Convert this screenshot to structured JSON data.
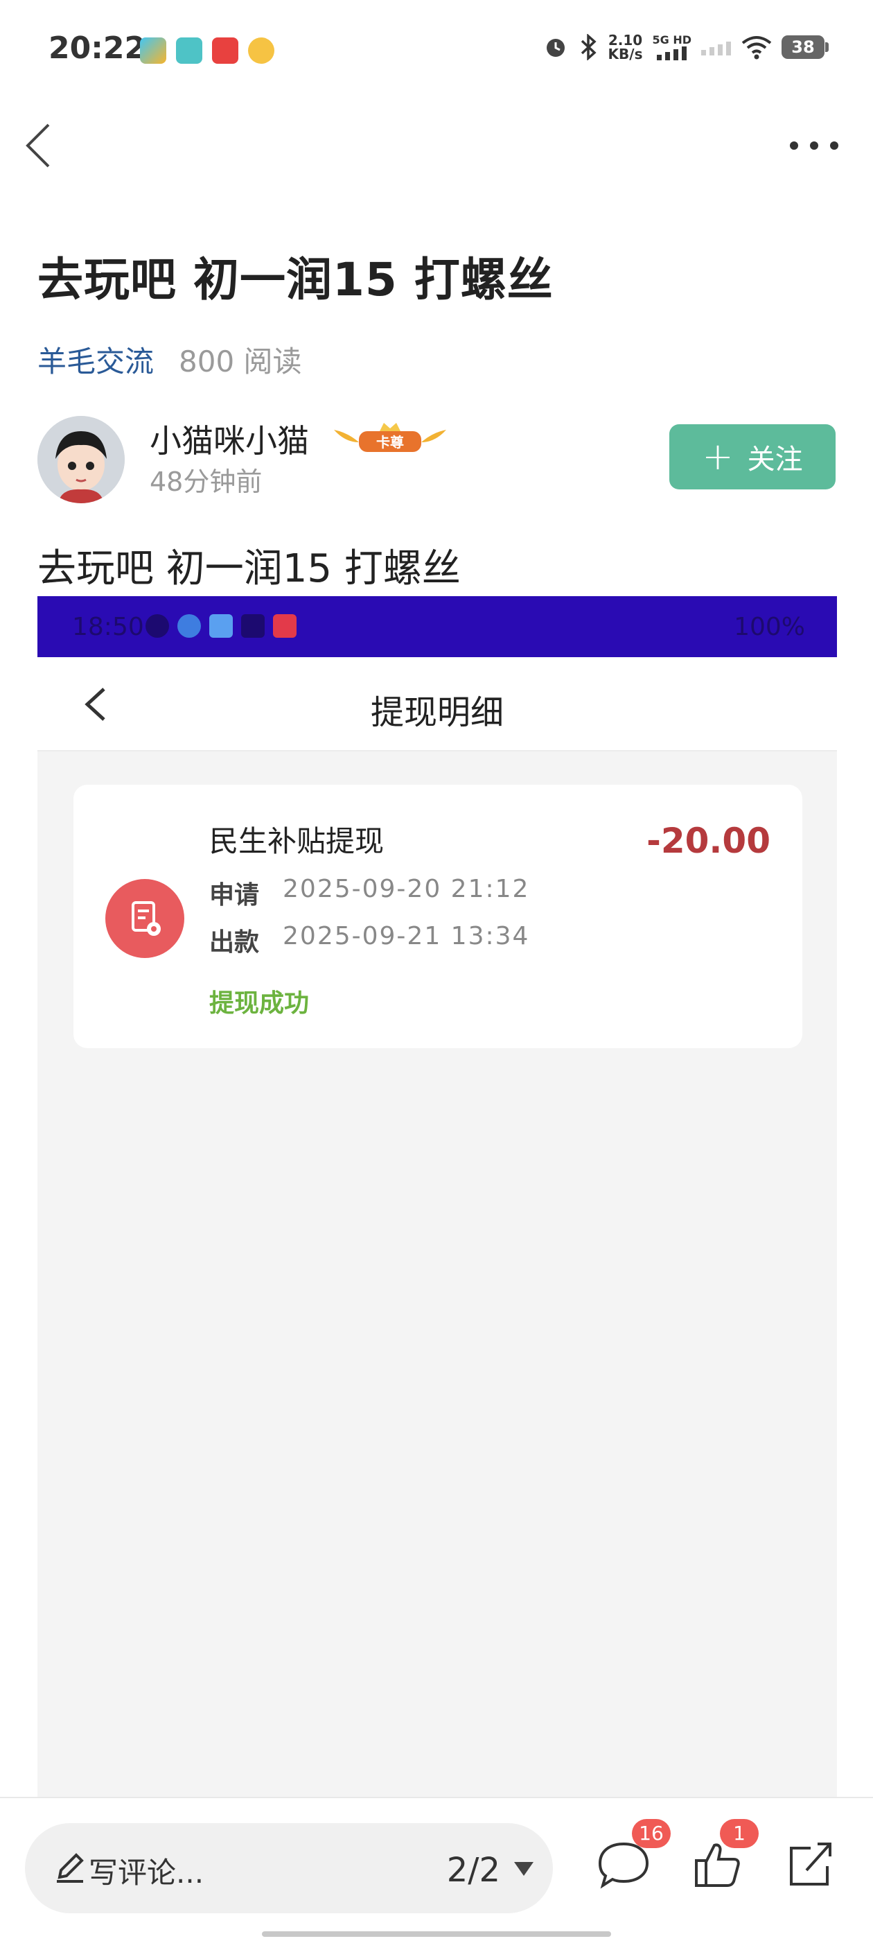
{
  "status_bar": {
    "time": "20:22",
    "net_speed_value": "2.10",
    "net_speed_unit": "KB/s",
    "network_type": "5G HD",
    "battery": "38"
  },
  "nav": {
    "back_icon": "chevron-left-icon",
    "more_icon": "more-horizontal-icon"
  },
  "post": {
    "title": "去玩吧 初一润15 打螺丝",
    "category": "羊毛交流",
    "reads": "800 阅读",
    "author": "小猫咪小猫",
    "badge": "卡尊",
    "time_ago": "48分钟前",
    "follow_label": "关注",
    "follow_plus": "+",
    "body": "去玩吧 初一润15 打螺丝"
  },
  "screenshot": {
    "status_time": "18:50",
    "status_battery": "100%",
    "page_title": "提现明细",
    "record": {
      "title": "民生补贴提现",
      "amount": "-20.00",
      "apply_label": "申请",
      "apply_time": "2025-09-20  21:12",
      "payout_label": "出款",
      "payout_time": "2025-09-21  13:34",
      "status": "提现成功"
    }
  },
  "bottom_bar": {
    "comment_placeholder": "写评论...",
    "page_indicator": "2/2",
    "comment_count": "16",
    "like_count": "1"
  },
  "colors": {
    "accent_follow": "#5dbb9b",
    "category_link": "#2a5a97",
    "amount": "#b53a3d",
    "success": "#6cb33f",
    "badge": "#f05a55"
  }
}
